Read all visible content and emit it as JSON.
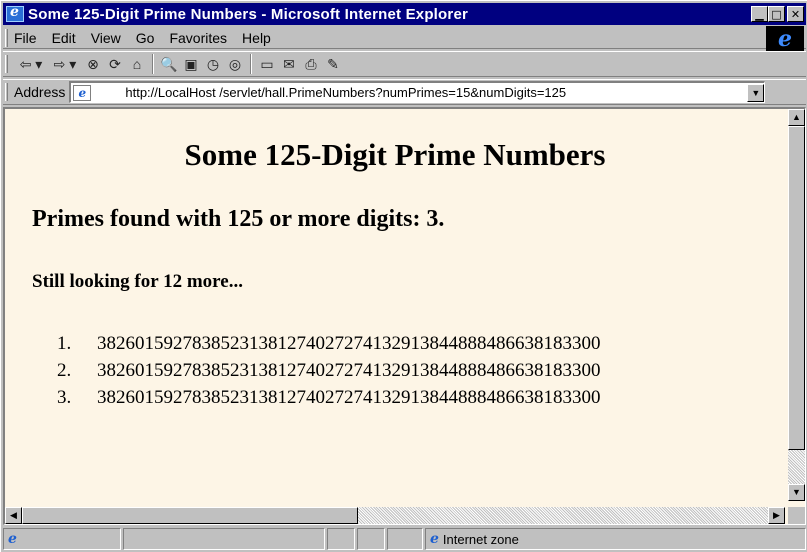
{
  "window": {
    "title": "Some 125-Digit Prime Numbers - Microsoft Internet Explorer",
    "minimize_glyph": "▁",
    "maximize_glyph": "□",
    "close_glyph": "✕"
  },
  "menu": {
    "items": [
      "File",
      "Edit",
      "View",
      "Go",
      "Favorites",
      "Help"
    ]
  },
  "toolbar": {
    "buttons": [
      {
        "icon": "back-icon",
        "glyph": "⇦ ▾"
      },
      {
        "icon": "forward-icon",
        "glyph": "⇨ ▾"
      },
      {
        "icon": "stop-icon",
        "glyph": "⊗"
      },
      {
        "icon": "refresh-icon",
        "glyph": "⟳"
      },
      {
        "icon": "home-icon",
        "glyph": "⌂"
      },
      {
        "icon": "search-icon",
        "glyph": "🔍"
      },
      {
        "icon": "favorites-icon",
        "glyph": "▣"
      },
      {
        "icon": "history-icon",
        "glyph": "◷"
      },
      {
        "icon": "channels-icon",
        "glyph": "◎"
      },
      {
        "icon": "fullscreen-icon",
        "glyph": "▭"
      },
      {
        "icon": "mail-icon",
        "glyph": "✉"
      },
      {
        "icon": "print-icon",
        "glyph": "⎙"
      },
      {
        "icon": "edit-icon",
        "glyph": "✎"
      }
    ]
  },
  "address": {
    "label": "Address",
    "url": "http://LocalHost /servlet/hall.PrimeNumbers?numPrimes=15&numDigits=125",
    "dropdown_glyph": "▼"
  },
  "page": {
    "heading": "Some 125-Digit Prime Numbers",
    "found_text": "Primes found with 125 or more digits: 3.",
    "looking_text": "Still looking for 12 more...",
    "primes": [
      {
        "num": "1.",
        "value": "38260159278385231381274027274132913844888486638183300"
      },
      {
        "num": "2.",
        "value": "38260159278385231381274027274132913844888486638183300"
      },
      {
        "num": "3.",
        "value": "38260159278385231381274027274132913844888486638183300"
      }
    ],
    "background_color": "#fdf5e6"
  },
  "status": {
    "zone_label": "Internet zone"
  }
}
